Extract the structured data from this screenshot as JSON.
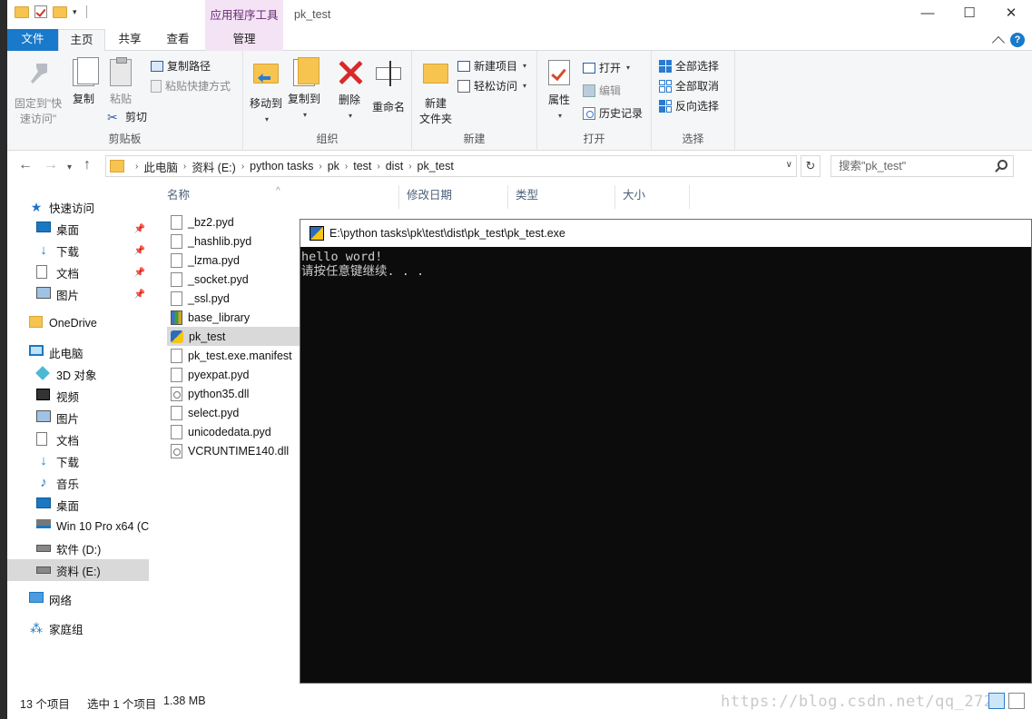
{
  "qat": {
    "tools_label": "应用程序工具",
    "window_title": "pk_test"
  },
  "window_buttons": {
    "minimize": "—",
    "maximize": "☐",
    "close": "✕"
  },
  "tabs": {
    "file": "文件",
    "home": "主页",
    "share": "共享",
    "view": "查看",
    "manage": "管理",
    "help": "?"
  },
  "ribbon": {
    "clipboard": {
      "label": "剪贴板",
      "pin_quick_access": "固定到\"快速访问\"",
      "copy": "复制",
      "paste": "粘贴",
      "copy_path": "复制路径",
      "paste_shortcut": "粘贴快捷方式",
      "cut": "剪切"
    },
    "organize": {
      "label": "组织",
      "move_to": "移动到",
      "copy_to": "复制到",
      "delete": "删除",
      "rename": "重命名"
    },
    "new": {
      "label": "新建",
      "new_folder": "新建\n文件夹",
      "new_item": "新建项目",
      "easy_access": "轻松访问"
    },
    "open": {
      "label": "打开",
      "properties": "属性",
      "open": "打开",
      "edit": "编辑",
      "history": "历史记录"
    },
    "select": {
      "label": "选择",
      "select_all": "全部选择",
      "select_none": "全部取消",
      "invert": "反向选择"
    }
  },
  "address": {
    "crumbs": [
      "此电脑",
      "资料 (E:)",
      "python tasks",
      "pk",
      "test",
      "dist",
      "pk_test"
    ],
    "search_placeholder": "搜索\"pk_test\""
  },
  "nav": {
    "quick_access": "快速访问",
    "qa_items": [
      "桌面",
      "下载",
      "文档",
      "图片"
    ],
    "onedrive": "OneDrive",
    "this_pc": "此电脑",
    "pc_items": [
      "3D 对象",
      "视频",
      "图片",
      "文档",
      "下载",
      "音乐",
      "桌面",
      "Win 10 Pro x64 (C",
      "软件 (D:)",
      "资料 (E:)"
    ],
    "network": "网络",
    "homegroup": "家庭组"
  },
  "columns": {
    "name": "名称",
    "date": "修改日期",
    "type": "类型",
    "size": "大小"
  },
  "files": [
    {
      "name": "_bz2.pyd",
      "icon": "file-icon"
    },
    {
      "name": "_hashlib.pyd",
      "icon": "file-icon"
    },
    {
      "name": "_lzma.pyd",
      "icon": "file-icon"
    },
    {
      "name": "_socket.pyd",
      "icon": "file-icon"
    },
    {
      "name": "_ssl.pyd",
      "icon": "file-icon"
    },
    {
      "name": "base_library",
      "icon": "zip-icon"
    },
    {
      "name": "pk_test",
      "icon": "exe-icon"
    },
    {
      "name": "pk_test.exe.manifest",
      "icon": "file-icon"
    },
    {
      "name": "pyexpat.pyd",
      "icon": "file-icon"
    },
    {
      "name": "python35.dll",
      "icon": "dll-icon"
    },
    {
      "name": "select.pyd",
      "icon": "file-icon"
    },
    {
      "name": "unicodedata.pyd",
      "icon": "file-icon"
    },
    {
      "name": "VCRUNTIME140.dll",
      "icon": "dll-icon"
    }
  ],
  "selected_file": "pk_test",
  "status": {
    "item_count": "13 个项目",
    "selection": "选中 1 个项目",
    "size": "1.38 MB",
    "watermark": "https://blog.csdn.net/qq_2728"
  },
  "console": {
    "title": "E:\\python tasks\\pk\\test\\dist\\pk_test\\pk_test.exe",
    "lines": [
      "hello word!",
      "请按任意键继续. . ."
    ]
  },
  "colors": {
    "accent": "#1979ca",
    "context_tab": "#f3e3f5",
    "selection": "#d9d9d9",
    "console_bg": "#0c0c0c"
  }
}
